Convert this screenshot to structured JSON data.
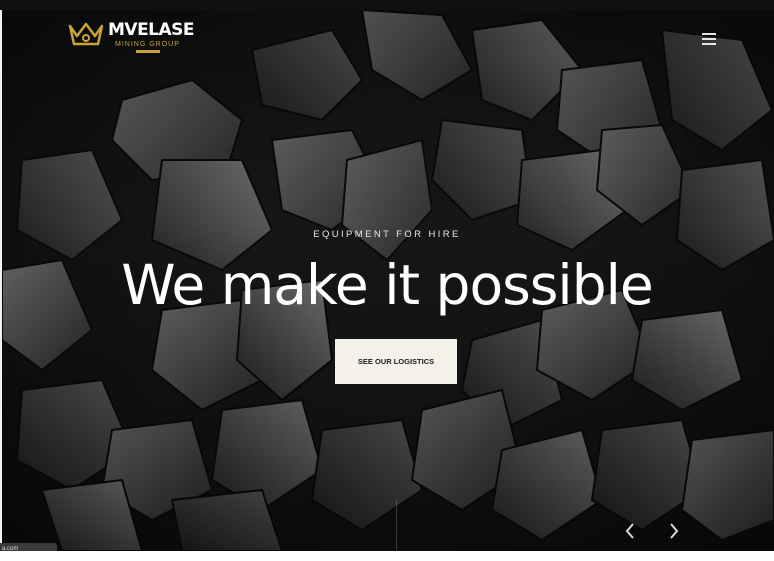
{
  "brand": {
    "name": "MVELASE",
    "tagline": "MINING GROUP",
    "logo_icon": "crown-icon",
    "accent_color": "#c9a43a"
  },
  "nav": {
    "menu_icon": "hamburger-menu-icon"
  },
  "hero": {
    "eyebrow": "EQUIPMENT FOR HIRE",
    "headline": "We make it possible",
    "cta_label": "SEE OUR LOGISTICS",
    "background": "dark-coal-rocks-photo"
  },
  "slider": {
    "prev_icon": "chevron-left-icon",
    "next_icon": "chevron-right-icon"
  },
  "status_bar": {
    "url_text": "a.com"
  }
}
